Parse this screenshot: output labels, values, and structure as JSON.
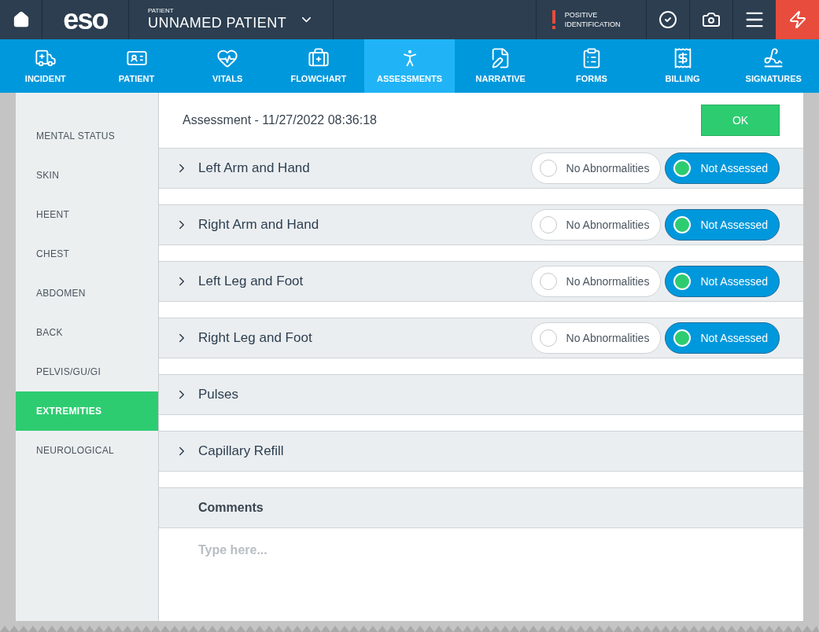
{
  "header": {
    "logo": "eso",
    "patient_label": "PATIENT",
    "patient_name": "UNNAMED PATIENT",
    "alert": "POSITIVE IDENTIFICATION"
  },
  "nav": [
    {
      "label": "INCIDENT",
      "selected": false
    },
    {
      "label": "PATIENT",
      "selected": false
    },
    {
      "label": "VITALS",
      "selected": false
    },
    {
      "label": "FLOWCHART",
      "selected": false
    },
    {
      "label": "ASSESSMENTS",
      "selected": true
    },
    {
      "label": "NARRATIVE",
      "selected": false
    },
    {
      "label": "FORMS",
      "selected": false
    },
    {
      "label": "BILLING",
      "selected": false
    },
    {
      "label": "SIGNATURES",
      "selected": false
    }
  ],
  "sidebar": [
    {
      "label": "MENTAL STATUS",
      "selected": false
    },
    {
      "label": "SKIN",
      "selected": false
    },
    {
      "label": "HEENT",
      "selected": false
    },
    {
      "label": "CHEST",
      "selected": false
    },
    {
      "label": "ABDOMEN",
      "selected": false
    },
    {
      "label": "BACK",
      "selected": false
    },
    {
      "label": "PELVIS/GU/GI",
      "selected": false
    },
    {
      "label": "EXTREMITIES",
      "selected": true
    },
    {
      "label": "NEUROLOGICAL",
      "selected": false
    }
  ],
  "assessment": {
    "title": "Assessment - 11/27/2022 08:36:18",
    "ok": "OK"
  },
  "sections": [
    {
      "kind": "options",
      "label": "Left Arm and Hand",
      "expanded": false,
      "options": [
        {
          "label": "No Abnormalities",
          "selected": false
        },
        {
          "label": "Not Assessed",
          "selected": true
        }
      ]
    },
    {
      "kind": "options",
      "label": "Right Arm and Hand",
      "expanded": false,
      "options": [
        {
          "label": "No Abnormalities",
          "selected": false
        },
        {
          "label": "Not Assessed",
          "selected": true
        }
      ]
    },
    {
      "kind": "options",
      "label": "Left Leg and Foot",
      "expanded": false,
      "options": [
        {
          "label": "No Abnormalities",
          "selected": false
        },
        {
          "label": "Not Assessed",
          "selected": true
        }
      ]
    },
    {
      "kind": "options",
      "label": "Right Leg and Foot",
      "expanded": false,
      "options": [
        {
          "label": "No Abnormalities",
          "selected": false
        },
        {
          "label": "Not Assessed",
          "selected": true
        }
      ]
    },
    {
      "kind": "plain",
      "label": "Pulses",
      "expanded": false
    },
    {
      "kind": "plain",
      "label": "Capillary Refill",
      "expanded": false
    }
  ],
  "comments": {
    "label": "Comments",
    "placeholder": "Type here..."
  }
}
